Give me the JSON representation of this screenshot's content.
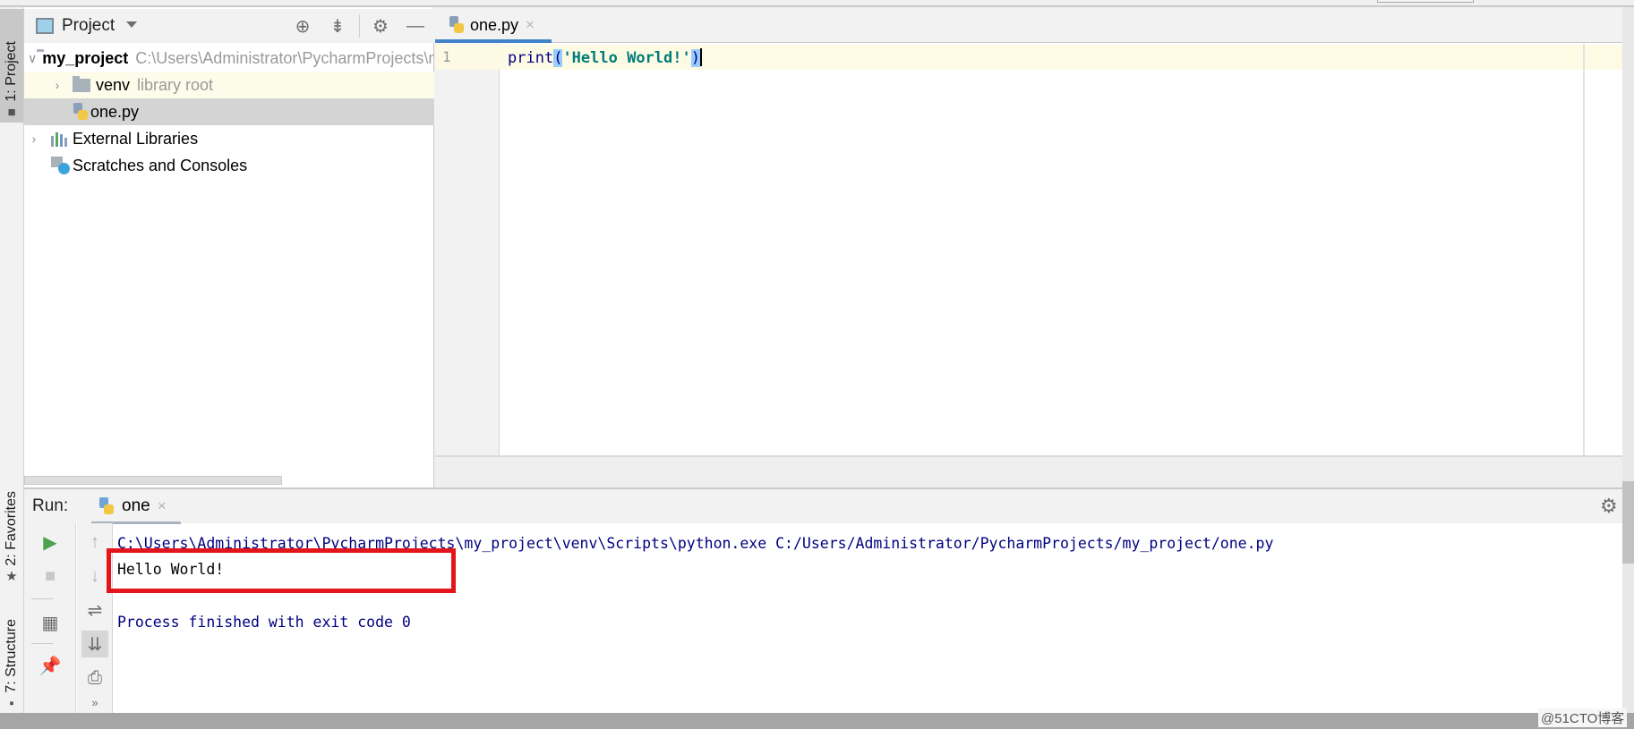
{
  "left_stripe": {
    "project": {
      "label": "1: Project",
      "icon": "folder-icon"
    },
    "favorites": {
      "label": "2: Favorites",
      "icon": "star-icon"
    },
    "structure": {
      "label": "7: Structure",
      "icon": "structure-icon"
    }
  },
  "project_panel": {
    "title": "Project",
    "header_icons": [
      "locate-icon",
      "collapse-all-icon",
      "gear-icon",
      "minimize-icon"
    ],
    "tree": [
      {
        "label": "my_project",
        "hint": "C:\\Users\\Administrator\\PycharmProjects\\my_project",
        "icon": "folder-icon",
        "expanded": true
      },
      {
        "label": "venv",
        "hint": "library root",
        "icon": "folder-icon",
        "expanded": false
      },
      {
        "label": "one.py",
        "icon": "python-file-icon",
        "selected": true
      },
      {
        "label": "External Libraries",
        "icon": "libraries-icon",
        "expanded": false
      },
      {
        "label": "Scratches and Consoles",
        "icon": "scratches-icon"
      }
    ]
  },
  "editor": {
    "tab": {
      "label": "one.py",
      "close": "×"
    },
    "line_number": "1",
    "code": {
      "fn": "print",
      "open": "(",
      "string": "'Hello World!'",
      "close": ")"
    }
  },
  "run_panel": {
    "label": "Run:",
    "tab": {
      "label": "one",
      "close": "×"
    },
    "console": {
      "command": "C:\\Users\\Administrator\\PycharmProjects\\my_project\\venv\\Scripts\\python.exe C:/Users/Administrator/PycharmProjects/my_project/one.py",
      "output": "Hello World!",
      "exit": "Process finished with exit code 0"
    },
    "highlight_color": "#e3151b"
  },
  "watermark": "@51CTO博客"
}
